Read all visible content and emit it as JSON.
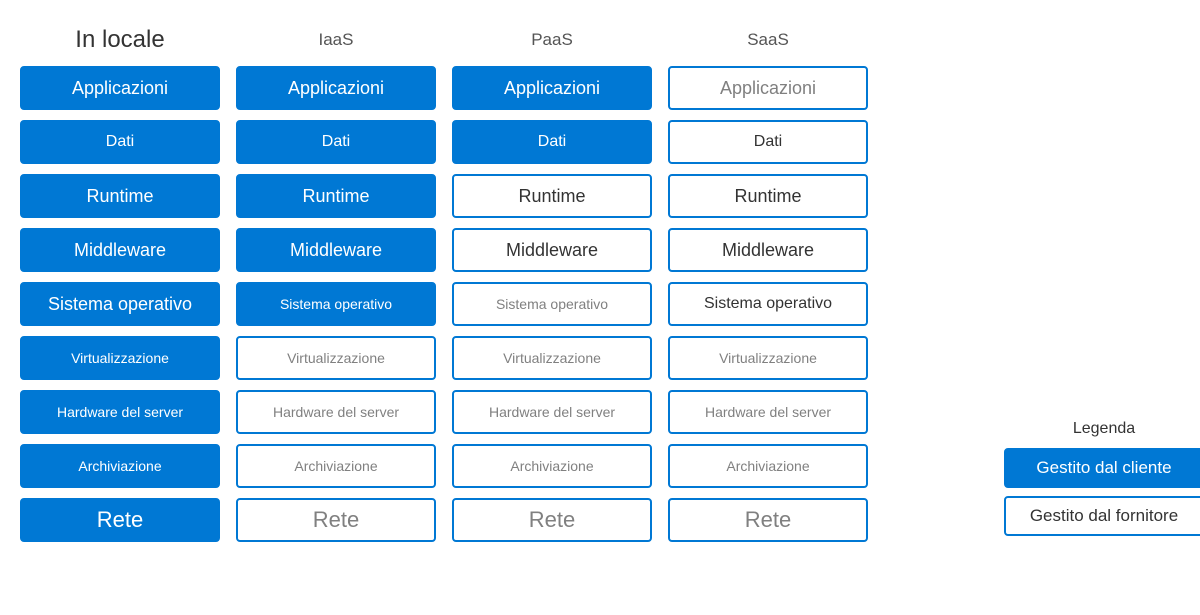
{
  "columns": [
    {
      "header": "In locale",
      "headerClass": "big",
      "cells": [
        {
          "label": "Applicazioni",
          "style": "blue",
          "textClass": "med-text"
        },
        {
          "label": "Dati",
          "style": "blue",
          "textClass": ""
        },
        {
          "label": "Runtime",
          "style": "blue",
          "textClass": "med-text"
        },
        {
          "label": "Middleware",
          "style": "blue",
          "textClass": "med-text"
        },
        {
          "label": "Sistema operativo",
          "style": "blue",
          "textClass": "med-text"
        },
        {
          "label": "Virtualizzazione",
          "style": "blue",
          "textClass": "small-text"
        },
        {
          "label": "Hardware del server",
          "style": "blue",
          "textClass": "small-text"
        },
        {
          "label": "Archiviazione",
          "style": "blue",
          "textClass": "small-text"
        },
        {
          "label": "Rete",
          "style": "blue",
          "textClass": "big-text"
        }
      ]
    },
    {
      "header": "IaaS",
      "headerClass": "mid",
      "cells": [
        {
          "label": "Applicazioni",
          "style": "blue",
          "textClass": "med-text"
        },
        {
          "label": "Dati",
          "style": "blue",
          "textClass": ""
        },
        {
          "label": "Runtime",
          "style": "blue",
          "textClass": "med-text"
        },
        {
          "label": "Middleware",
          "style": "blue",
          "textClass": "med-text"
        },
        {
          "label": "Sistema operativo",
          "style": "blue",
          "textClass": "small-text"
        },
        {
          "label": "Virtualizzazione",
          "style": "white",
          "textClass": "small-text gray-text"
        },
        {
          "label": "Hardware del server",
          "style": "white",
          "textClass": "small-text gray-text"
        },
        {
          "label": "Archiviazione",
          "style": "white",
          "textClass": "small-text gray-text"
        },
        {
          "label": "Rete",
          "style": "white",
          "textClass": "big-text gray-text"
        }
      ]
    },
    {
      "header": "PaaS",
      "headerClass": "mid",
      "cells": [
        {
          "label": "Applicazioni",
          "style": "blue",
          "textClass": "med-text"
        },
        {
          "label": "Dati",
          "style": "blue",
          "textClass": ""
        },
        {
          "label": "Runtime",
          "style": "white",
          "textClass": "med-text"
        },
        {
          "label": "Middleware",
          "style": "white",
          "textClass": "med-text"
        },
        {
          "label": "Sistema operativo",
          "style": "white",
          "textClass": "small-text gray-text"
        },
        {
          "label": "Virtualizzazione",
          "style": "white",
          "textClass": "small-text gray-text"
        },
        {
          "label": "Hardware del server",
          "style": "white",
          "textClass": "small-text gray-text"
        },
        {
          "label": "Archiviazione",
          "style": "white",
          "textClass": "small-text gray-text"
        },
        {
          "label": "Rete",
          "style": "white",
          "textClass": "big-text gray-text"
        }
      ]
    },
    {
      "header": "SaaS",
      "headerClass": "mid",
      "cells": [
        {
          "label": "Applicazioni",
          "style": "white",
          "textClass": "med-text gray-text"
        },
        {
          "label": "Dati",
          "style": "white",
          "textClass": ""
        },
        {
          "label": "Runtime",
          "style": "white",
          "textClass": "med-text"
        },
        {
          "label": "Middleware",
          "style": "white",
          "textClass": "med-text"
        },
        {
          "label": "Sistema operativo",
          "style": "white",
          "textClass": ""
        },
        {
          "label": "Virtualizzazione",
          "style": "white",
          "textClass": "small-text gray-text"
        },
        {
          "label": "Hardware del server",
          "style": "white",
          "textClass": "small-text gray-text"
        },
        {
          "label": "Archiviazione",
          "style": "white",
          "textClass": "small-text gray-text"
        },
        {
          "label": "Rete",
          "style": "white",
          "textClass": "big-text gray-text"
        }
      ]
    }
  ],
  "legend": {
    "title": "Legenda",
    "items": [
      {
        "label": "Gestito dal cliente",
        "style": "blue"
      },
      {
        "label": "Gestito dal fornitore",
        "style": "white"
      }
    ]
  }
}
